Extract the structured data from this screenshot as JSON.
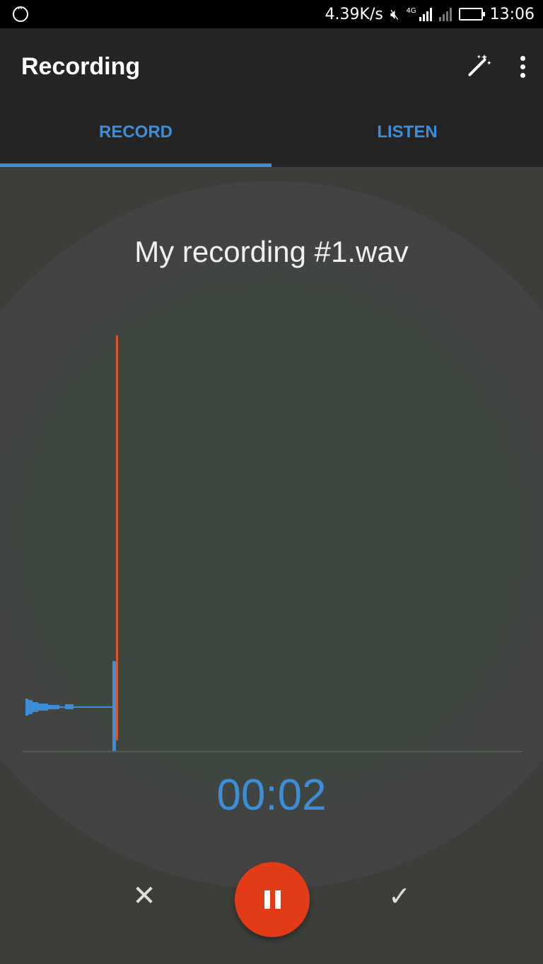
{
  "status_bar": {
    "net_speed": "4.39K/s",
    "network_label": "4G",
    "time": "13:06",
    "icons": [
      "message-icon",
      "mute-icon",
      "signal-icon",
      "battery-icon"
    ]
  },
  "app_bar": {
    "title": "Recording",
    "actions": [
      "magic-wand-icon",
      "more-options-icon"
    ]
  },
  "tabs": [
    {
      "label": "RECORD",
      "active": true
    },
    {
      "label": "LISTEN",
      "active": false
    }
  ],
  "recording": {
    "file_name": "My recording #1.wav",
    "elapsed": "00:02"
  },
  "controls": {
    "cancel_glyph": "✕",
    "confirm_glyph": "✓",
    "pause_icon": "pause-icon"
  },
  "colors": {
    "accent": "#3d8ed8",
    "record_red": "#e23b17",
    "playhead": "#e0522a",
    "app_bar": "#242424",
    "status_bar": "#000000"
  }
}
